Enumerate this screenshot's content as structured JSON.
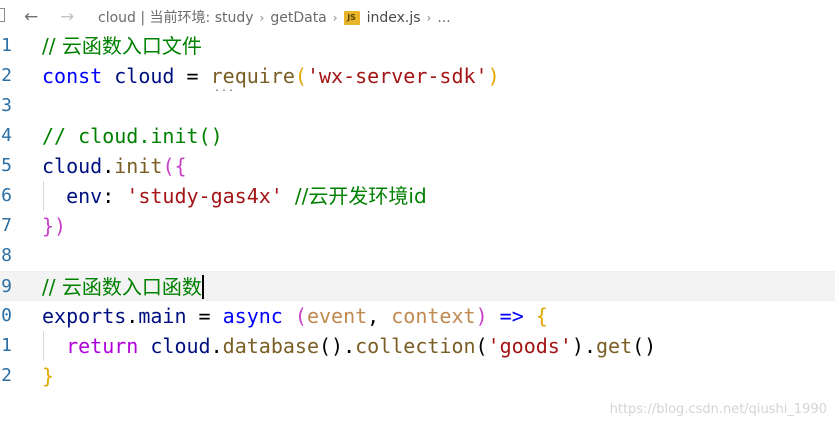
{
  "breadcrumb": {
    "back_icon": "←",
    "forward_icon": "→",
    "segments": [
      "cloud | 当前环境: study",
      "getData",
      "index.js",
      "..."
    ],
    "separator": "›",
    "file_badge": "JS"
  },
  "editor": {
    "line_numbers": [
      "1",
      "2",
      "3",
      "4",
      "5",
      "6",
      "7",
      "8",
      "9",
      "0",
      "1",
      "2"
    ],
    "lines": {
      "l1": {
        "comment": "// 云函数入口文件"
      },
      "l2": {
        "kw": "const",
        "ident": " cloud ",
        "eq": "= ",
        "func": "require",
        "open": "(",
        "str": "'wx-server-sdk'",
        "close": ")",
        "squiggle": "..."
      },
      "l4": {
        "comment": "// cloud.init()"
      },
      "l5": {
        "obj": "cloud",
        "dot": ".",
        "func": "init",
        "open": "({"
      },
      "l6": {
        "indent": "  ",
        "key": "env",
        "colon": ": ",
        "str": "'study-gas4x'",
        "space": " ",
        "comment": "//云开发环境id"
      },
      "l7": {
        "close": "})"
      },
      "l9": {
        "comment": "// 云函数入口函数"
      },
      "l10": {
        "obj": "exports",
        "dot": ".",
        "prop": "main",
        "eq": " = ",
        "kw": "async",
        "space": " ",
        "open": "(",
        "p1": "event",
        "comma": ", ",
        "p2": "context",
        "close": ")",
        "arrow": " => ",
        "brace": "{"
      },
      "l11": {
        "indent": "  ",
        "kw": "return",
        "space": " ",
        "obj": "cloud",
        "dot1": ".",
        "f1": "database",
        "parens1": "()",
        "dot2": ".",
        "f2": "collection",
        "open2": "(",
        "str": "'goods'",
        "close2": ")",
        "dot3": ".",
        "f3": "get",
        "parens3": "()"
      },
      "l12": {
        "brace": "}"
      }
    }
  },
  "watermark": "https://blog.csdn.net/qiushi_1990",
  "colors": {
    "comment": "#008000",
    "keyword": "#0000ff",
    "control_keyword": "#af00db",
    "identifier": "#001080",
    "function": "#795e26",
    "string": "#a31515",
    "line_number": "#2b6fa5",
    "current_line_bg": "#f3f3f3"
  }
}
